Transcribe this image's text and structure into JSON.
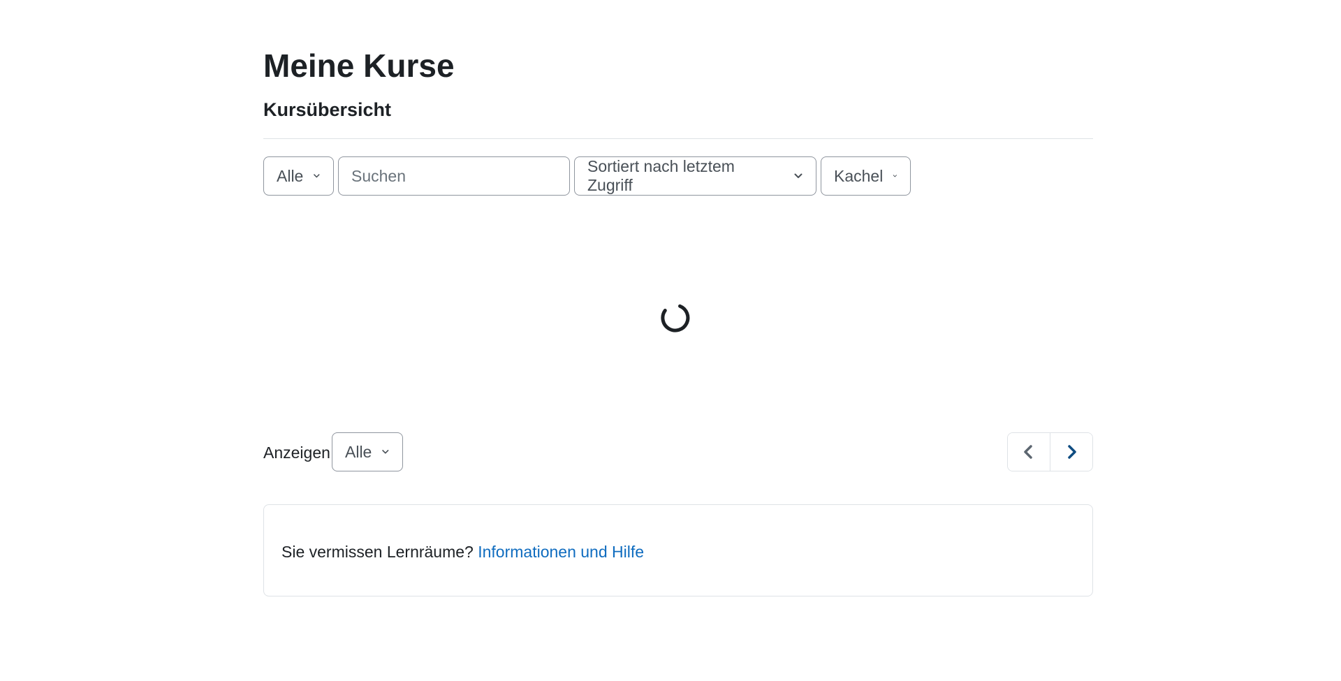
{
  "page": {
    "title": "Meine Kurse",
    "section_title": "Kursübersicht"
  },
  "filters": {
    "grouping": {
      "selected": "Alle",
      "icon": "chevron-down-icon"
    },
    "search": {
      "placeholder": "Suchen",
      "value": ""
    },
    "sort": {
      "selected": "Sortiert nach letztem Zugriff",
      "icon": "chevron-down-icon"
    },
    "view": {
      "selected": "Kachel",
      "icon": "chevron-down-icon"
    }
  },
  "loading": {
    "icon": "loading-spinner-icon"
  },
  "paging": {
    "show_label": "Anzeigen",
    "show_selected": "Alle",
    "prev_icon": "chevron-left-icon",
    "next_icon": "chevron-right-icon"
  },
  "info": {
    "text": "Sie vermissen Lernräume?",
    "link_text": "Informationen und Hilfe"
  },
  "colors": {
    "text": "#1d2125",
    "muted": "#495057",
    "border": "#8f959e",
    "divider": "#dee2e6",
    "link": "#0f6cbf",
    "pager_prev": "#5c6670",
    "pager_next": "#0f4c81"
  }
}
